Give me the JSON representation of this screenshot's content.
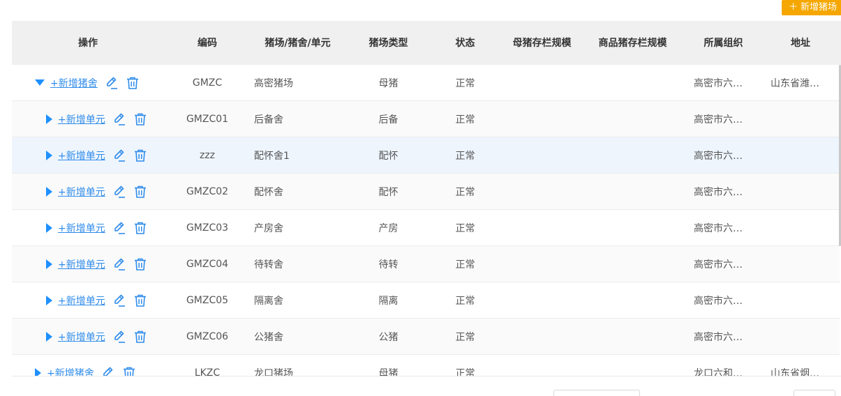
{
  "toolbar": {
    "add_farm_label": "新增猪场"
  },
  "table": {
    "headers": {
      "ops": "操作",
      "code": "编码",
      "name": "猪场/猪舍/单元",
      "type": "猪场类型",
      "status": "状态",
      "sow_scale": "母猪存栏规模",
      "commodity_scale": "商品猪存栏规模",
      "org": "所属组织",
      "address": "地址"
    },
    "rows": [
      {
        "level": 0,
        "expanded": true,
        "add_label": "+新增猪舍",
        "code": "GMZC",
        "name": "高密猪场",
        "type": "母猪",
        "status": "正常",
        "sow_scale": "",
        "commodity_scale": "",
        "org": "高密市六…",
        "address": "山东省潍…"
      },
      {
        "level": 1,
        "expanded": false,
        "add_label": "+新增单元",
        "code": "GMZC01",
        "name": "后备舍",
        "type": "后备",
        "status": "正常",
        "sow_scale": "",
        "commodity_scale": "",
        "org": "高密市六…",
        "address": ""
      },
      {
        "level": 1,
        "expanded": false,
        "add_label": "+新增单元",
        "code": "zzz",
        "name": "配怀舍1",
        "type": "配怀",
        "status": "正常",
        "sow_scale": "",
        "commodity_scale": "",
        "org": "高密市六…",
        "address": ""
      },
      {
        "level": 1,
        "expanded": false,
        "add_label": "+新增单元",
        "code": "GMZC02",
        "name": "配怀舍",
        "type": "配怀",
        "status": "正常",
        "sow_scale": "",
        "commodity_scale": "",
        "org": "高密市六…",
        "address": ""
      },
      {
        "level": 1,
        "expanded": false,
        "add_label": "+新增单元",
        "code": "GMZC03",
        "name": "产房舍",
        "type": "产房",
        "status": "正常",
        "sow_scale": "",
        "commodity_scale": "",
        "org": "高密市六…",
        "address": ""
      },
      {
        "level": 1,
        "expanded": false,
        "add_label": "+新增单元",
        "code": "GMZC04",
        "name": "待转舍",
        "type": "待转",
        "status": "正常",
        "sow_scale": "",
        "commodity_scale": "",
        "org": "高密市六…",
        "address": ""
      },
      {
        "level": 1,
        "expanded": false,
        "add_label": "+新增单元",
        "code": "GMZC05",
        "name": "隔离舍",
        "type": "隔离",
        "status": "正常",
        "sow_scale": "",
        "commodity_scale": "",
        "org": "高密市六…",
        "address": ""
      },
      {
        "level": 1,
        "expanded": false,
        "add_label": "+新增单元",
        "code": "GMZC06",
        "name": "公猪舍",
        "type": "公猪",
        "status": "正常",
        "sow_scale": "",
        "commodity_scale": "",
        "org": "高密市六…",
        "address": ""
      },
      {
        "level": 0,
        "expanded": false,
        "add_label": "+新增猪舍",
        "code": "LKZC",
        "name": "龙口猪场",
        "type": "母猪",
        "status": "正常",
        "sow_scale": "",
        "commodity_scale": "",
        "org": "龙口六和…",
        "address": "山东省烟…"
      }
    ],
    "highlighted_row": 2
  },
  "colors": {
    "accent": "#2f8ceb",
    "add_button": "#f5a700",
    "header_bg": "#f0f0f0",
    "highlight_row": "#eef5fd"
  },
  "icons": {
    "edit": "pencil-icon",
    "delete": "trash-icon",
    "expand": "caret-down-icon",
    "collapse": "caret-right-icon"
  }
}
